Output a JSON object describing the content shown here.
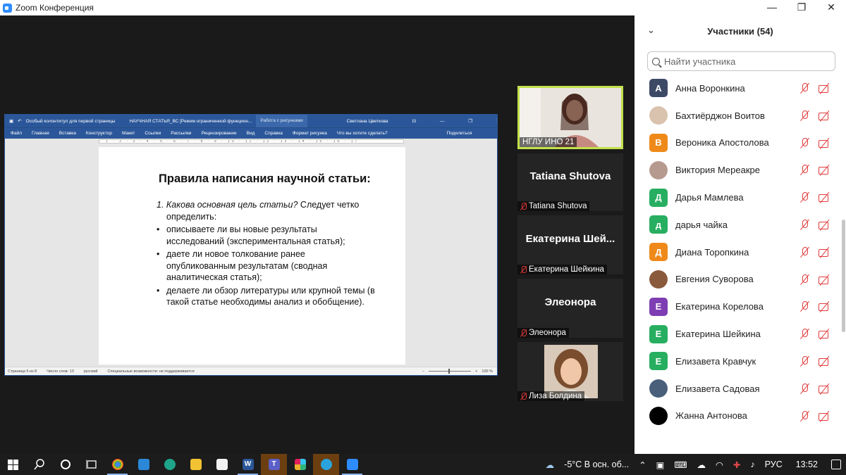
{
  "window": {
    "title": "Zoom Конференция",
    "controls": [
      "—",
      "❐",
      "✕"
    ]
  },
  "word": {
    "quick_title": "Особый колонтитул для первой страницы",
    "doc_title": "НАУЧНАЯ СТАТЬЯ_ВС [Режим ограниченной функцион...",
    "context_tab": "Работа с рисунками",
    "user": "Светлана Цветкова",
    "ribbon_tabs": [
      "Файл",
      "Главная",
      "Вставка",
      "Конструктор",
      "Макет",
      "Ссылки",
      "Рассылки",
      "Рецензирование",
      "Вид",
      "Справка",
      "Формат рисунка"
    ],
    "tell_me": "Что вы хотите сделать?",
    "share": "Поделиться",
    "ruler": "· 1 · 2 · 3 · 4 · 5 · 6 · 7 · 8 · 9 · 10 · 11 · 12 · 13 · 14 · 15 · 16 · 17",
    "page": {
      "heading": "Правила написания научной статьи:",
      "numbered_italic": "1. Какова основная цель статьи?",
      "numbered_rest": " Следует четко определить:",
      "bullets": [
        "описываете ли вы новые результаты исследований (экспериментальная статья);",
        "даете ли новое толкование ранее опубликованным результатам (сводная аналитическая статья);",
        "делаете ли обзор литературы или крупной темы (в такой статье необходимы анализ и обобщение)."
      ]
    },
    "status": {
      "page": "Страница 5 из 8",
      "words": "Число слов: 13",
      "lang": "русский",
      "access": "Специальные возможности: не поддерживается",
      "zoom": "100 %"
    }
  },
  "videos": [
    {
      "big": "",
      "name": "НГЛУ ИНО 21",
      "muted": false
    },
    {
      "big": "Tatiana Shutova",
      "name": "Tatiana Shutova",
      "muted": true
    },
    {
      "big": "Екатерина  Шей...",
      "name": "Екатерина Шейкина",
      "muted": true
    },
    {
      "big": "Элеонора",
      "name": "Элеонора",
      "muted": true
    },
    {
      "big": "",
      "name": "Лиза Болдина",
      "muted": true
    }
  ],
  "participants_panel": {
    "title": "Участники (54)",
    "search_placeholder": "Найти участника",
    "participants": [
      {
        "name": "Анна Воронкина",
        "initial": "А",
        "color": "#3d4a66",
        "photo": false
      },
      {
        "name": "Бахтиёрджон Воитов",
        "initial": "",
        "color": "#d9c3ae",
        "photo": true
      },
      {
        "name": "Вероника Апостолова",
        "initial": "В",
        "color": "#ef8a1a",
        "photo": false
      },
      {
        "name": "Виктория Мереакре",
        "initial": "",
        "color": "#b79a8f",
        "photo": true
      },
      {
        "name": "Дарья Мамлева",
        "initial": "Д",
        "color": "#27ae60",
        "photo": false
      },
      {
        "name": "дарья чайка",
        "initial": "д",
        "color": "#27ae60",
        "photo": false
      },
      {
        "name": "Диана Торопкина",
        "initial": "Д",
        "color": "#ef8a1a",
        "photo": false
      },
      {
        "name": "Евгения Суворова",
        "initial": "",
        "color": "#8a5a3c",
        "photo": true
      },
      {
        "name": "Екатерина Корелова",
        "initial": "Е",
        "color": "#7e3db3",
        "photo": false
      },
      {
        "name": "Екатерина Шейкина",
        "initial": "Е",
        "color": "#27ae60",
        "photo": false
      },
      {
        "name": "Елизавета Кравчук",
        "initial": "Е",
        "color": "#27ae60",
        "photo": false
      },
      {
        "name": "Елизавета Садовая",
        "initial": "",
        "color": "#4a5f7a",
        "photo": true
      },
      {
        "name": "Жанна Антонова",
        "initial": "",
        "color": "#000000",
        "photo": true
      }
    ]
  },
  "taskbar": {
    "weather": "-5°C  В осн. об...",
    "lang": "РУС",
    "time": "13:52"
  },
  "colors": {
    "word_blue": "#2b579a",
    "active_border": "#c2e14b",
    "muted_red": "#e03a3a"
  }
}
